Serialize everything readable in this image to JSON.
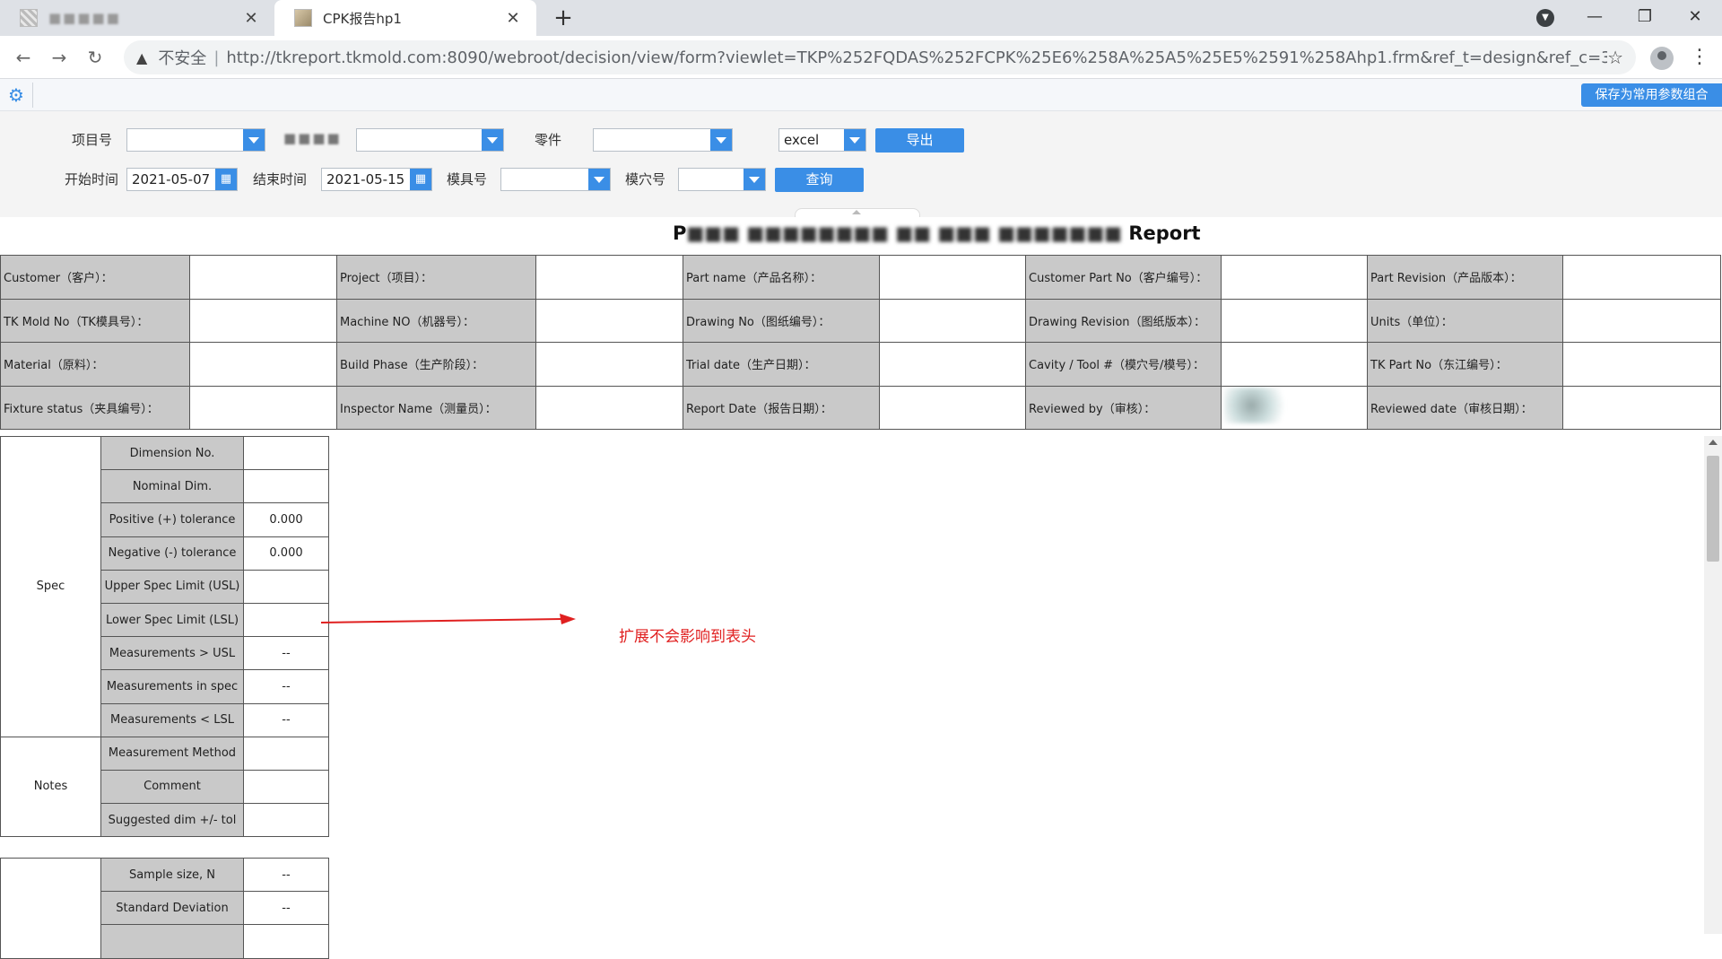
{
  "browser": {
    "tabs": [
      {
        "title": "■■■■■",
        "active": false
      },
      {
        "title": "CPK报告hp1",
        "active": true
      }
    ],
    "new_tab_label": "+",
    "close_label": "✕",
    "address": {
      "security_label": "不安全",
      "url": "http://tkreport.tkmold.com:8090/webroot/decision/view/form?viewlet=TKP%252FQDAS%252FCPK%25E6%258A%25A5%25E5%2591%258Ahp1.frm&ref_t=design&ref_c=30b24fe3-d..."
    }
  },
  "toolbar": {
    "save_combo_label": "保存为常用参数组合",
    "accent_color": "#3a8ee6"
  },
  "params": {
    "project_label": "项目号",
    "project_value": "",
    "blurred_label": "■■■■",
    "blurred_value": "",
    "part_label": "零件",
    "part_value": "",
    "format_value": "excel",
    "export_label": "导出",
    "start_label": "开始时间",
    "start_value": "2021-05-07",
    "end_label": "结束时间",
    "end_value": "2021-05-15",
    "mold_label": "模具号",
    "mold_value": "",
    "cavity_label": "模穴号",
    "cavity_value": "",
    "query_label": "查询"
  },
  "report": {
    "title_prefix": "P",
    "title_blurred": "■■■ ■■■■■■■■ ■■ ■■■ ■■■■■■■",
    "title_suffix": "Report",
    "header_rows": [
      [
        "Customer（客户）：",
        "Project（项目）：",
        "Part name（产品名称）：",
        "Customer Part No（客户编号）：",
        "Part Revision（产品版本）："
      ],
      [
        "TK Mold No（TK模具号）：",
        "Machine NO（机器号）：",
        "Drawing No（图纸编号）：",
        "Drawing Revision（图纸版本）：",
        "Units（单位）："
      ],
      [
        "Material（原料）：",
        "Build Phase（生产阶段）：",
        "Trial date（生产日期）：",
        "Cavity / Tool #（模穴号/模号）：",
        "TK Part No（东江编号）："
      ],
      [
        "Fixture status（夹具编号）：",
        "Inspector Name（测量员）：",
        "Report Date（报告日期）：",
        "Reviewed by（审核）：",
        "Reviewed date（审核日期）："
      ]
    ],
    "spec_group": "Spec",
    "spec_rows": [
      {
        "label": "Dimension No.",
        "value": ""
      },
      {
        "label": "Nominal Dim.",
        "value": ""
      },
      {
        "label": "Positive (+) tolerance",
        "value": "0.000"
      },
      {
        "label": "Negative (-) tolerance",
        "value": "0.000"
      },
      {
        "label": "Upper Spec Limit (USL)",
        "value": ""
      },
      {
        "label": "Lower Spec Limit (LSL)",
        "value": ""
      },
      {
        "label": "Measurements > USL",
        "value": "--"
      },
      {
        "label": "Measurements in spec",
        "value": "--"
      },
      {
        "label": "Measurements < LSL",
        "value": "--"
      }
    ],
    "notes_group": "Notes",
    "notes_rows": [
      {
        "label": "Measurement Method",
        "value": ""
      },
      {
        "label": "Comment",
        "value": ""
      },
      {
        "label": "Suggested dim +/- tol",
        "value": ""
      }
    ],
    "stats_rows": [
      {
        "label": "Sample size, N",
        "value": "--"
      },
      {
        "label": "Standard Deviation",
        "value": "--"
      }
    ]
  },
  "annotation": {
    "text": "扩展不会影响到表头",
    "color": "#e02020"
  }
}
